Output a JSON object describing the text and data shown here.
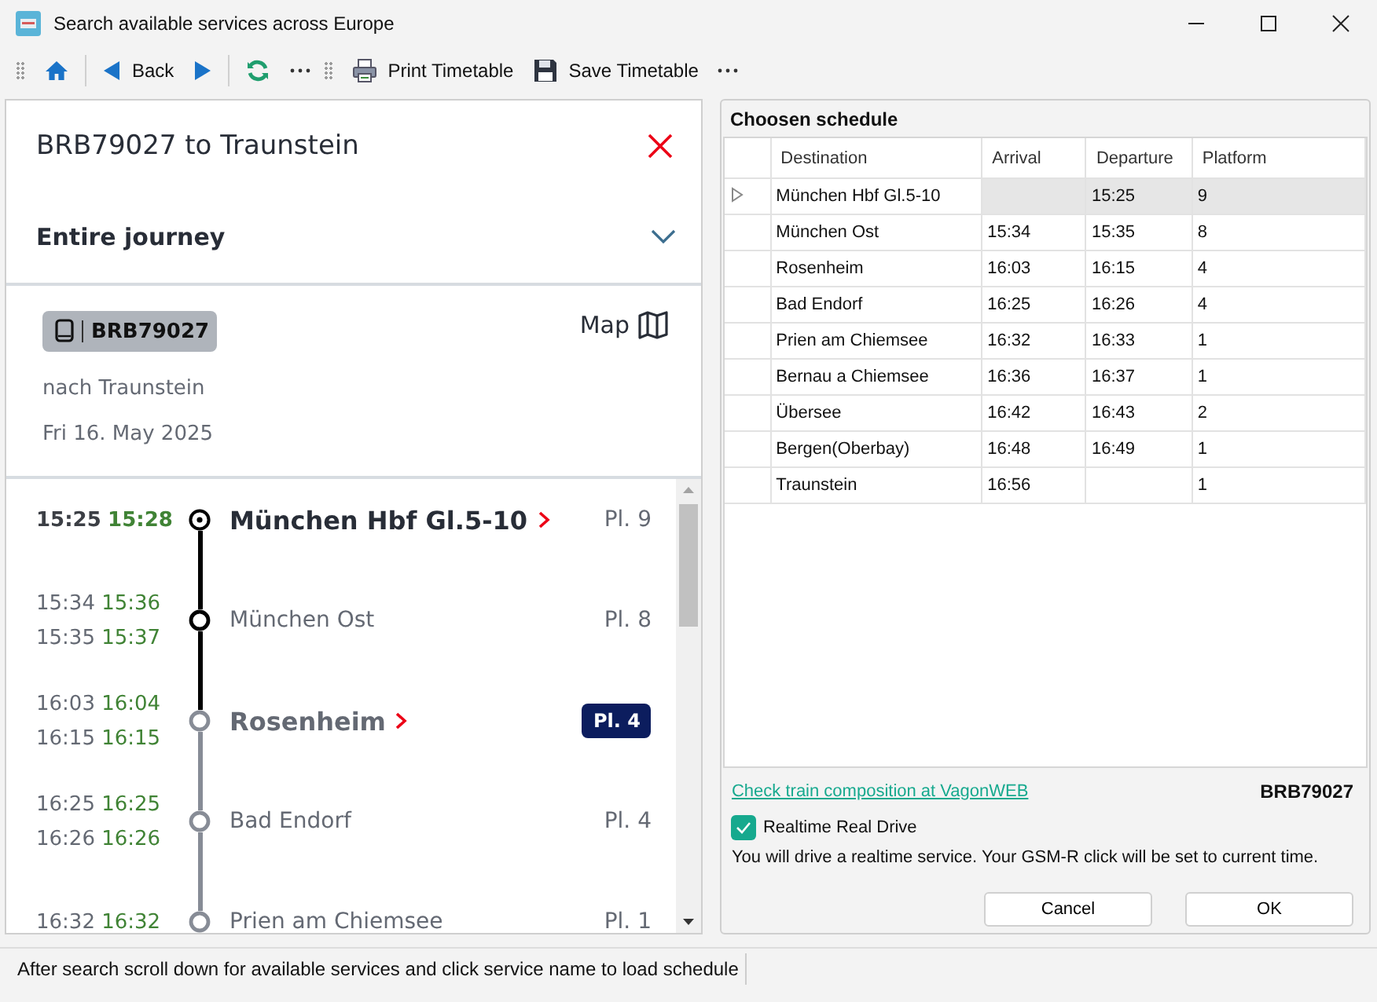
{
  "window": {
    "title": "Search available services across Europe"
  },
  "toolbar": {
    "items": [
      {
        "kind": "home"
      },
      {
        "kind": "back",
        "label": "Back"
      },
      {
        "kind": "forward"
      },
      {
        "kind": "refresh"
      },
      {
        "kind": "more"
      },
      {
        "kind": "print",
        "label": "Print Timetable"
      },
      {
        "kind": "save",
        "label": "Save Timetable"
      },
      {
        "kind": "more"
      }
    ]
  },
  "journey": {
    "title": "BRB79027 to Traunstein",
    "section": "Entire journey",
    "train": {
      "number": "BRB79027",
      "direction": "nach Traunstein",
      "date": "Fri 16. May 2025"
    },
    "map": "Map",
    "stops": [
      {
        "kind": "origin",
        "times": [
          {
            "planned": "15:25",
            "actual": "15:28"
          }
        ],
        "name": "München Hbf Gl.5-10",
        "major": true,
        "platform": "Pl. 9",
        "platform_highlighted": false,
        "passed": true
      },
      {
        "kind": "stop",
        "times": [
          {
            "planned": "15:34",
            "actual": "15:36"
          },
          {
            "planned": "15:35",
            "actual": "15:37"
          }
        ],
        "name": "München Ost",
        "major": false,
        "platform": "Pl. 8",
        "platform_highlighted": false,
        "passed": true
      },
      {
        "kind": "stop",
        "times": [
          {
            "planned": "16:03",
            "actual": "16:04"
          },
          {
            "planned": "16:15",
            "actual": "16:15"
          }
        ],
        "name": "Rosenheim",
        "major": true,
        "platform": "Pl. 4",
        "platform_highlighted": true,
        "passed": false
      },
      {
        "kind": "stop",
        "times": [
          {
            "planned": "16:25",
            "actual": "16:25"
          },
          {
            "planned": "16:26",
            "actual": "16:26"
          }
        ],
        "name": "Bad Endorf",
        "major": false,
        "platform": "Pl. 4",
        "platform_highlighted": false,
        "passed": false
      },
      {
        "kind": "stop",
        "times": [
          {
            "planned": "16:32",
            "actual": "16:32"
          }
        ],
        "name": "Prien am Chiemsee",
        "major": false,
        "platform": "Pl. 1",
        "platform_highlighted": false,
        "passed": false
      }
    ]
  },
  "schedule": {
    "title": "Choosen schedule",
    "columns": [
      "Destination",
      "Arrival",
      "Departure",
      "Platform"
    ],
    "rows": [
      {
        "cells": [
          "München Hbf Gl.5-10",
          "",
          "15:25",
          "9"
        ],
        "selected": true
      },
      {
        "cells": [
          "München Ost",
          "15:34",
          "15:35",
          "8"
        ],
        "selected": false
      },
      {
        "cells": [
          "Rosenheim",
          "16:03",
          "16:15",
          "4"
        ],
        "selected": false
      },
      {
        "cells": [
          "Bad Endorf",
          "16:25",
          "16:26",
          "4"
        ],
        "selected": false
      },
      {
        "cells": [
          "Prien am Chiemsee",
          "16:32",
          "16:33",
          "1"
        ],
        "selected": false
      },
      {
        "cells": [
          "Bernau a Chiemsee",
          "16:36",
          "16:37",
          "1"
        ],
        "selected": false
      },
      {
        "cells": [
          "Übersee",
          "16:42",
          "16:43",
          "2"
        ],
        "selected": false
      },
      {
        "cells": [
          "Bergen(Oberbay)",
          "16:48",
          "16:49",
          "1"
        ],
        "selected": false
      },
      {
        "cells": [
          "Traunstein",
          "16:56",
          "",
          "1"
        ],
        "selected": false
      }
    ],
    "link": "Check train composition at VagonWEB",
    "train_number": "BRB79027",
    "realtime": {
      "label": "Realtime Real Drive",
      "checked": true
    },
    "note": "You will drive a realtime service. Your GSM-R click will be set to current time.",
    "buttons": [
      "Cancel",
      "OK"
    ]
  },
  "status_bar": {
    "text": "After search scroll down for available services and click service name to load schedule"
  }
}
